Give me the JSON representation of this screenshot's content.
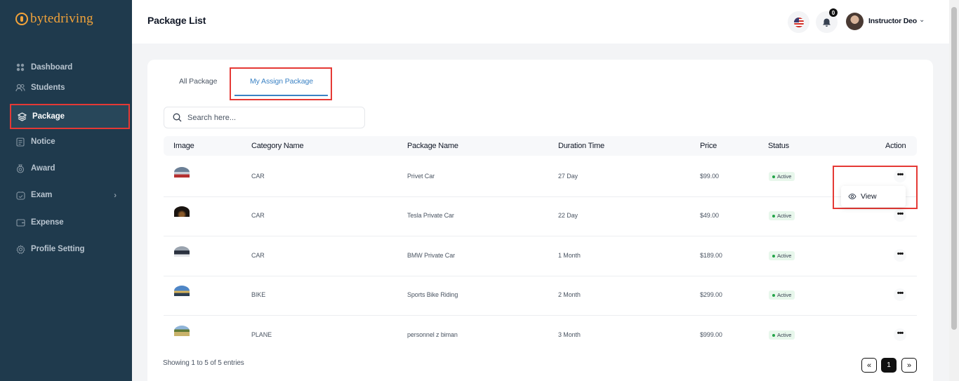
{
  "brand": {
    "name": "bytedriving"
  },
  "sidebar": {
    "items": [
      {
        "label": "Dashboard",
        "icon": "grid-icon"
      },
      {
        "label": "Students",
        "icon": "users-icon"
      },
      {
        "label": "Package",
        "icon": "layers-icon",
        "active": true
      },
      {
        "label": "Notice",
        "icon": "document-icon"
      },
      {
        "label": "Award",
        "icon": "award-icon"
      },
      {
        "label": "Exam",
        "icon": "exam-icon",
        "has_submenu": true
      },
      {
        "label": "Expense",
        "icon": "wallet-icon"
      },
      {
        "label": "Profile Setting",
        "icon": "gear-icon"
      }
    ]
  },
  "header": {
    "title": "Package List",
    "notification_count": "0",
    "user_name": "Instructor Deo"
  },
  "tabs": [
    {
      "label": "All Package"
    },
    {
      "label": "My Assign Package",
      "active": true
    }
  ],
  "search": {
    "placeholder": "Search here..."
  },
  "table": {
    "columns": [
      "Image",
      "Category Name",
      "Package Name",
      "Duration Time",
      "Price",
      "Status",
      "Action"
    ],
    "rows": [
      {
        "category": "CAR",
        "package": "Privet Car",
        "duration": "27 Day",
        "price": "$99.00",
        "status": "Active"
      },
      {
        "category": "CAR",
        "package": "Tesla Private Car",
        "duration": "22 Day",
        "price": "$49.00",
        "status": "Active"
      },
      {
        "category": "CAR",
        "package": "BMW Private Car",
        "duration": "1 Month",
        "price": "$189.00",
        "status": "Active"
      },
      {
        "category": "BIKE",
        "package": "Sports Bike Riding",
        "duration": "2 Month",
        "price": "$299.00",
        "status": "Active"
      },
      {
        "category": "PLANE",
        "package": "personnel z biman",
        "duration": "3 Month",
        "price": "$999.00",
        "status": "Active"
      }
    ],
    "action_glyph": "•••"
  },
  "dropdown": {
    "view_label": "View"
  },
  "footer": {
    "entries_text": "Showing 1 to 5 of 5 entries",
    "prev": "«",
    "page": "1",
    "next": "»"
  },
  "colors": {
    "sidebar_bg": "#1f3a4d",
    "accent_blue": "#3b82c4",
    "brand_orange": "#f2a33a",
    "highlight_red": "#e53935",
    "active_green": "#22a447"
  }
}
